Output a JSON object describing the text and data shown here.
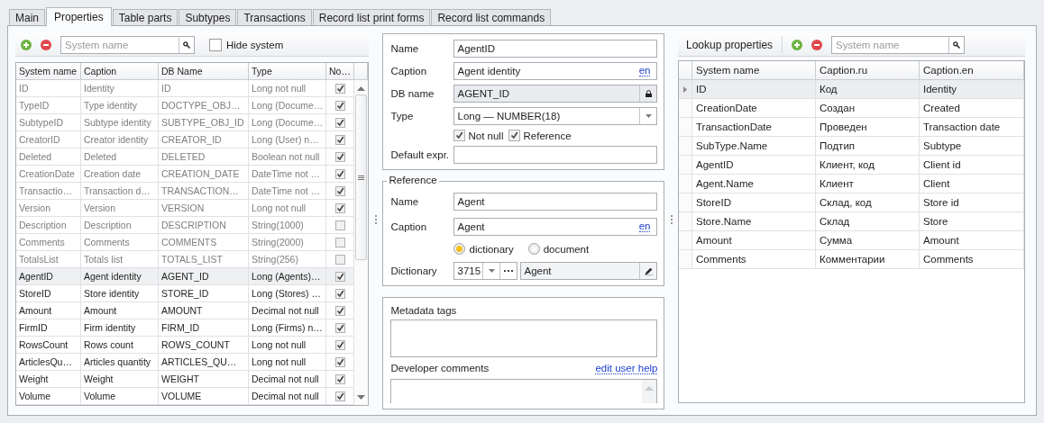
{
  "tabs": [
    {
      "label": "Main",
      "selected": false
    },
    {
      "label": "Properties",
      "selected": true
    },
    {
      "label": "Table parts",
      "selected": false
    },
    {
      "label": "Subtypes",
      "selected": false
    },
    {
      "label": "Transactions",
      "selected": false
    },
    {
      "label": "Record list print forms",
      "selected": false
    },
    {
      "label": "Record list commands",
      "selected": false
    }
  ],
  "properties": {
    "search": {
      "placeholder": "System name"
    },
    "hide_system": {
      "label": "Hide system",
      "checked": false
    },
    "columns": [
      "System name",
      "Caption",
      "DB Name",
      "Type",
      "No…"
    ],
    "rows": [
      {
        "system_name": "ID",
        "caption": "Identity",
        "db_name": "ID",
        "type": "Long not null",
        "not_null": true,
        "system": true,
        "selected": false
      },
      {
        "system_name": "TypeID",
        "caption": "Type identity",
        "db_name": "DOCTYPE_OBJ…",
        "type": "Long (Docume…",
        "not_null": true,
        "system": true,
        "selected": false
      },
      {
        "system_name": "SubtypeID",
        "caption": "Subtype identity",
        "db_name": "SUBTYPE_OBJ_ID",
        "type": "Long (Docume…",
        "not_null": true,
        "system": true,
        "selected": false
      },
      {
        "system_name": "CreatorID",
        "caption": "Creator identity",
        "db_name": "CREATOR_ID",
        "type": "Long (User) n…",
        "not_null": true,
        "system": true,
        "selected": false
      },
      {
        "system_name": "Deleted",
        "caption": "Deleted",
        "db_name": "DELETED",
        "type": "Boolean not null",
        "not_null": true,
        "system": true,
        "selected": false
      },
      {
        "system_name": "CreationDate",
        "caption": "Creation date",
        "db_name": "CREATION_DATE",
        "type": "DateTime not …",
        "not_null": true,
        "system": true,
        "selected": false
      },
      {
        "system_name": "Transactio…",
        "caption": "Transaction d…",
        "db_name": "TRANSACTION…",
        "type": "DateTime not …",
        "not_null": true,
        "system": true,
        "selected": false
      },
      {
        "system_name": "Version",
        "caption": "Version",
        "db_name": "VERSION",
        "type": "Long not null",
        "not_null": true,
        "system": true,
        "selected": false
      },
      {
        "system_name": "Description",
        "caption": "Description",
        "db_name": "DESCRIPTION",
        "type": "String(1000)",
        "not_null": false,
        "system": true,
        "selected": false
      },
      {
        "system_name": "Comments",
        "caption": "Comments",
        "db_name": "COMMENTS",
        "type": "String(2000)",
        "not_null": false,
        "system": true,
        "selected": false
      },
      {
        "system_name": "TotalsList",
        "caption": "Totals list",
        "db_name": "TOTALS_LIST",
        "type": "String(256)",
        "not_null": false,
        "system": true,
        "selected": false
      },
      {
        "system_name": "AgentID",
        "caption": "Agent identity",
        "db_name": "AGENT_ID",
        "type": "Long (Agents)…",
        "not_null": true,
        "system": false,
        "selected": true
      },
      {
        "system_name": "StoreID",
        "caption": "Store identity",
        "db_name": "STORE_ID",
        "type": "Long (Stores) …",
        "not_null": true,
        "system": false,
        "selected": false
      },
      {
        "system_name": "Amount",
        "caption": "Amount",
        "db_name": "AMOUNT",
        "type": "Decimal not null",
        "not_null": true,
        "system": false,
        "selected": false
      },
      {
        "system_name": "FirmID",
        "caption": "Firm identity",
        "db_name": "FIRM_ID",
        "type": "Long (Firms) n…",
        "not_null": true,
        "system": false,
        "selected": false
      },
      {
        "system_name": "RowsCount",
        "caption": "Rows count",
        "db_name": "ROWS_COUNT",
        "type": "Long not null",
        "not_null": true,
        "system": false,
        "selected": false
      },
      {
        "system_name": "ArticlesQu…",
        "caption": "Articles quantity",
        "db_name": "ARTICLES_QU…",
        "type": "Long not null",
        "not_null": true,
        "system": false,
        "selected": false
      },
      {
        "system_name": "Weight",
        "caption": "Weight",
        "db_name": "WEIGHT",
        "type": "Decimal not null",
        "not_null": true,
        "system": false,
        "selected": false
      },
      {
        "system_name": "Volume",
        "caption": "Volume",
        "db_name": "VOLUME",
        "type": "Decimal not null",
        "not_null": true,
        "system": false,
        "selected": false
      }
    ]
  },
  "editor": {
    "name": {
      "label": "Name",
      "value": "AgentID"
    },
    "caption": {
      "label": "Caption",
      "value": "Agent identity",
      "lang": "en"
    },
    "db_name": {
      "label": "DB name",
      "value": "AGENT_ID"
    },
    "type": {
      "label": "Type",
      "value": "Long — NUMBER(18)"
    },
    "not_null": {
      "label": "Not null",
      "checked": true
    },
    "reference": {
      "label": "Reference",
      "checked": true
    },
    "default_expr": {
      "label": "Default expr."
    }
  },
  "reference": {
    "title": "Reference",
    "name": {
      "label": "Name",
      "value": "Agent"
    },
    "caption": {
      "label": "Caption",
      "value": "Agent",
      "lang": "en"
    },
    "options": [
      {
        "label": "dictionary",
        "selected": true
      },
      {
        "label": "document",
        "selected": false
      }
    ],
    "dictionary": {
      "label": "Dictionary",
      "id": "3715",
      "value": "Agent"
    }
  },
  "notes": {
    "tags_label": "Metadata tags",
    "comments_label": "Developer comments",
    "help_link": "edit user help"
  },
  "lookup": {
    "title": "Lookup properties",
    "search": {
      "placeholder": "System name"
    },
    "columns": [
      "System name",
      "Caption.ru",
      "Caption.en"
    ],
    "rows": [
      {
        "system_name": "ID",
        "caption_ru": "Код",
        "caption_en": "Identity",
        "selected": true
      },
      {
        "system_name": "CreationDate",
        "caption_ru": "Создан",
        "caption_en": "Created",
        "selected": false
      },
      {
        "system_name": "TransactionDate",
        "caption_ru": "Проведен",
        "caption_en": "Transaction date",
        "selected": false
      },
      {
        "system_name": "SubType.Name",
        "caption_ru": "Подтип",
        "caption_en": "Subtype",
        "selected": false
      },
      {
        "system_name": "AgentID",
        "caption_ru": "Клиент, код",
        "caption_en": "Client id",
        "selected": false
      },
      {
        "system_name": "Agent.Name",
        "caption_ru": "Клиент",
        "caption_en": "Client",
        "selected": false
      },
      {
        "system_name": "StoreID",
        "caption_ru": "Склад, код",
        "caption_en": "Store id",
        "selected": false
      },
      {
        "system_name": "Store.Name",
        "caption_ru": "Склад",
        "caption_en": "Store",
        "selected": false
      },
      {
        "system_name": "Amount",
        "caption_ru": "Сумма",
        "caption_en": "Amount",
        "selected": false
      },
      {
        "system_name": "Comments",
        "caption_ru": "Комментарии",
        "caption_en": "Comments",
        "selected": false
      }
    ]
  }
}
